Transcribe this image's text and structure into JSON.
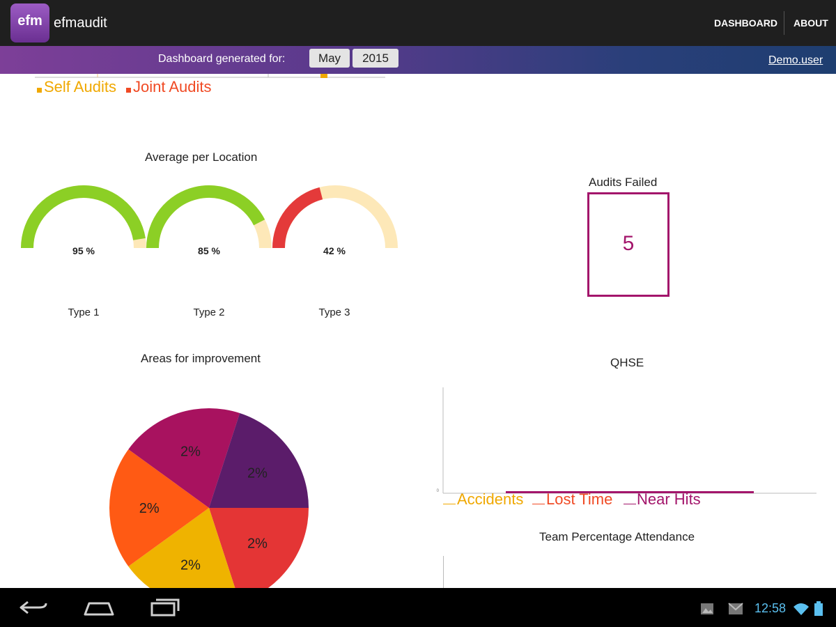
{
  "app": {
    "logo_text": "efm",
    "title": "efmaudit"
  },
  "nav": {
    "dashboard": "DASHBOARD",
    "about": "ABOUT"
  },
  "subheader": {
    "label": "Dashboard generated for:",
    "month": "May",
    "year": "2015",
    "user": "Demo.user"
  },
  "audits_legend": {
    "self": "Self Audits",
    "joint": "Joint Audits"
  },
  "gauges": {
    "title": "Average per Location",
    "items": [
      {
        "label": "Type 1",
        "value": 95,
        "display": "95 %",
        "color": "#8ccf25"
      },
      {
        "label": "Type 2",
        "value": 85,
        "display": "85 %",
        "color": "#8ccf25"
      },
      {
        "label": "Type 3",
        "value": 42,
        "display": "42 %",
        "color": "#e43a3a"
      }
    ],
    "track_color": "#fde8b8"
  },
  "audits_failed": {
    "title": "Audits Failed",
    "value": "5"
  },
  "chart_data": [
    {
      "type": "pie",
      "title": "Areas for improvement",
      "slices": [
        {
          "value": 20,
          "label": "2%",
          "color": "#e43535"
        },
        {
          "value": 20,
          "label": "2%",
          "color": "#efb300"
        },
        {
          "value": 20,
          "label": "2%",
          "color": "#ff5a14"
        },
        {
          "value": 20,
          "label": "2%",
          "color": "#a8125f"
        },
        {
          "value": 20,
          "label": "2%",
          "color": "#5b1c6a"
        }
      ]
    },
    {
      "type": "line",
      "title": "QHSE",
      "y_tick": "0",
      "series": [
        {
          "name": "Accidents",
          "color": "#f0a800",
          "values": [
            0,
            0,
            0,
            0,
            0
          ]
        },
        {
          "name": "Lost Time",
          "color": "#f04a24",
          "values": [
            0,
            0,
            0,
            0,
            0
          ]
        },
        {
          "name": "Near Hits",
          "color": "#a3156b",
          "values": [
            0,
            0,
            0,
            0,
            0
          ]
        }
      ]
    }
  ],
  "attendance": {
    "title": "Team Percentage Attendance"
  },
  "system": {
    "time": "12:58"
  }
}
